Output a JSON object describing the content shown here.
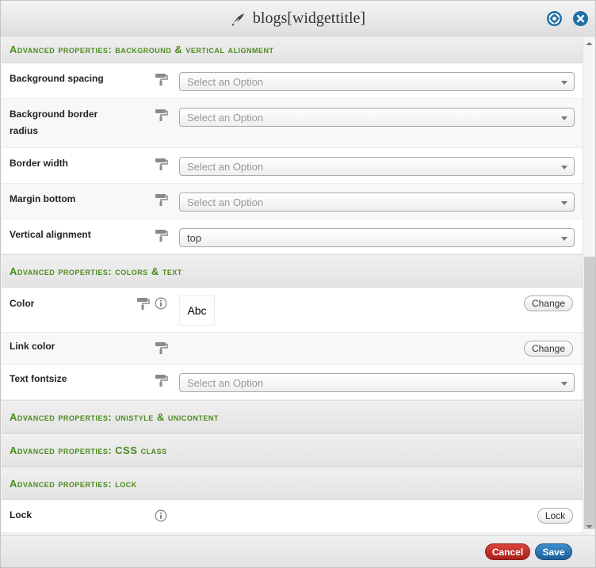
{
  "dialog": {
    "title": "blogs[widgettitle]"
  },
  "sections": {
    "background": {
      "title": "Advanced properties: background & vertical alignment"
    },
    "colors": {
      "title": "Advanced properties: colors & text"
    },
    "unistyle": {
      "title": "Advanced properties: unistyle & unicontent"
    },
    "css": {
      "title": "Advanced properties: CSS class"
    },
    "lock": {
      "title": "Advanced properties: lock"
    }
  },
  "rows": {
    "background_spacing": {
      "label": "Background spacing",
      "value": "Select an Option"
    },
    "background_border_radius": {
      "label": "Background border radius",
      "value": "Select an Option"
    },
    "border_width": {
      "label": "Border width",
      "value": "Select an Option"
    },
    "margin_bottom": {
      "label": "Margin bottom",
      "value": "Select an Option"
    },
    "vertical_alignment": {
      "label": "Vertical alignment",
      "value": "top"
    },
    "color": {
      "label": "Color",
      "preview": "Abc",
      "button": "Change"
    },
    "link_color": {
      "label": "Link color",
      "button": "Change"
    },
    "text_fontsize": {
      "label": "Text fontsize",
      "value": "Select an Option"
    },
    "lock": {
      "label": "Lock",
      "button": "Lock"
    }
  },
  "footer": {
    "cancel_label": "Cancel",
    "save_label": "Save"
  },
  "colors": {
    "section_title": "#4b8b1f",
    "accent_blue": "#1e6fa8",
    "cancel_red": "#c0312a",
    "save_blue": "#2f7bbd"
  },
  "icons": {
    "title": "feather-icon",
    "help": "lifebuoy-icon",
    "close": "close-icon",
    "style": "paint-roller-icon",
    "info": "info-icon"
  }
}
